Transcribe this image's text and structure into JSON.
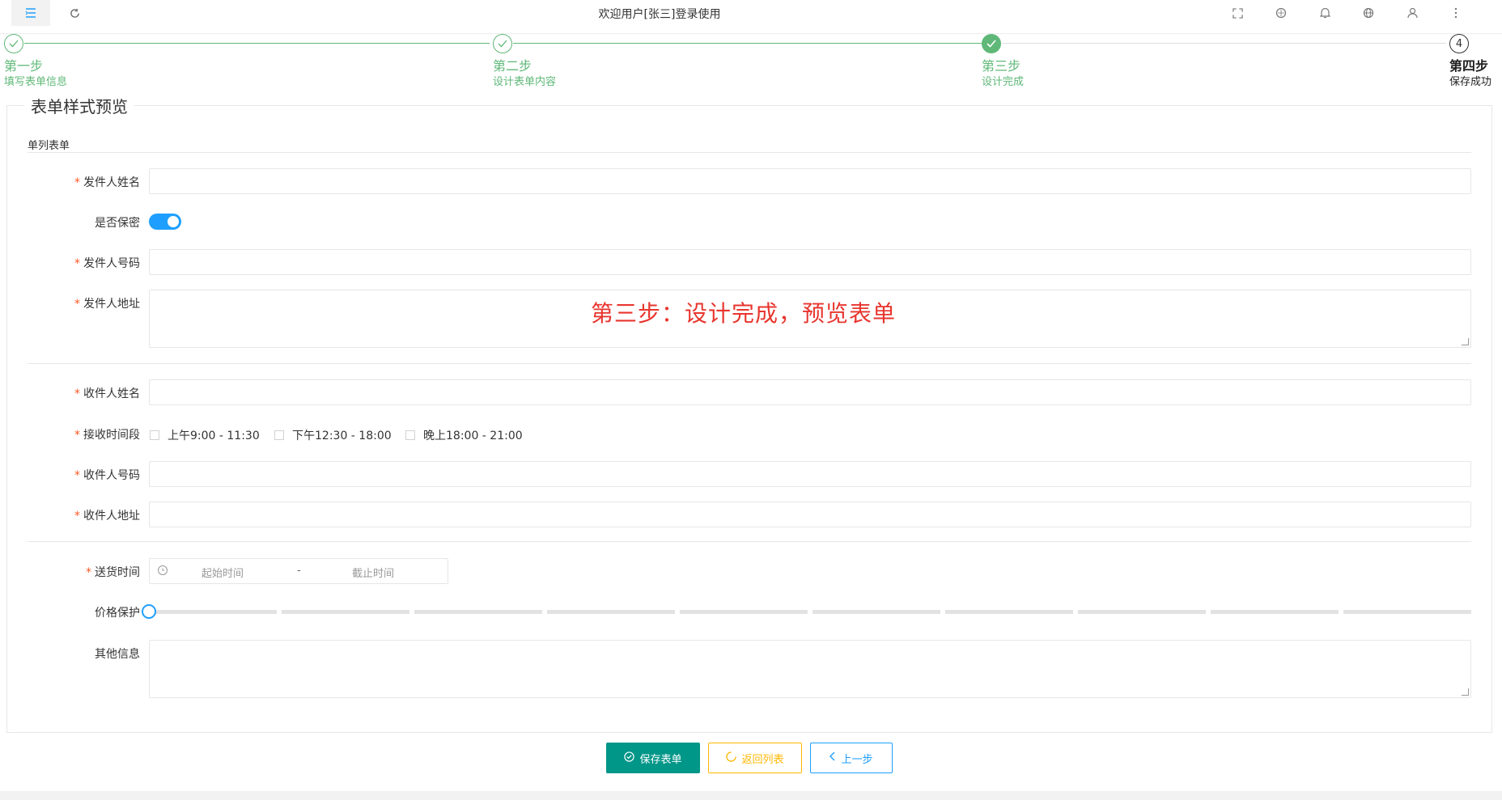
{
  "topbar": {
    "title": "欢迎用户[张三]登录使用",
    "left_icons": [
      "menu-fold-icon",
      "refresh-icon"
    ],
    "right_icons": [
      "fullscreen-icon",
      "theme-icon",
      "bell-icon",
      "globe-icon",
      "user-icon",
      "more-vertical-icon"
    ]
  },
  "steps": [
    {
      "title": "第一步",
      "desc": "填写表单信息",
      "state": "done"
    },
    {
      "title": "第二步",
      "desc": "设计表单内容",
      "state": "done"
    },
    {
      "title": "第三步",
      "desc": "设计完成",
      "state": "current"
    },
    {
      "title": "第四步",
      "desc": "保存成功",
      "state": "todo",
      "number": "4"
    }
  ],
  "form": {
    "legend": "表单样式预览",
    "section_title": "单列表单",
    "sender_name_label": "发件人姓名",
    "secret_label": "是否保密",
    "secret_on": true,
    "sender_phone_label": "发件人号码",
    "sender_address_label": "发件人地址",
    "receiver_name_label": "收件人姓名",
    "receive_time_label": "接收时间段",
    "receive_time_options": [
      "上午9:00 - 11:30",
      "下午12:30 - 18:00",
      "晚上18:00 - 21:00"
    ],
    "receiver_phone_label": "收件人号码",
    "receiver_address_label": "收件人地址",
    "delivery_time_label": "送货时间",
    "delivery_start_placeholder": "起始时间",
    "delivery_separator": "-",
    "delivery_end_placeholder": "截止时间",
    "price_protect_label": "价格保护",
    "price_protect_value": 0,
    "other_info_label": "其他信息",
    "required_mark": "*"
  },
  "annotation": "第三步：设计完成，预览表单",
  "buttons": {
    "save": "保存表单",
    "back_list": "返回列表",
    "prev": "上一步"
  },
  "colors": {
    "step_green": "#5fb878",
    "primary_teal": "#009688",
    "warm_yellow": "#ffb800",
    "normal_blue": "#1e9fff",
    "required_red": "#ff5722",
    "annotation_red": "#e8352e"
  }
}
